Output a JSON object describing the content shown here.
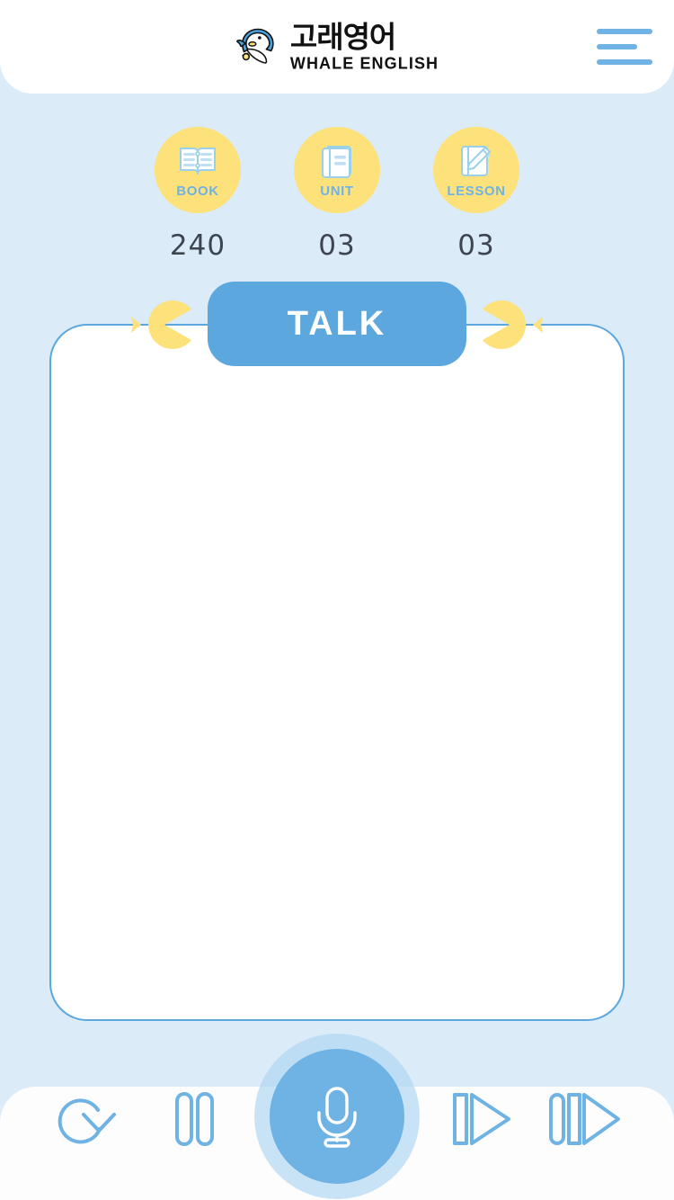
{
  "app": {
    "background_color": "#dbebf8",
    "accent_blue": "#5ba7de",
    "accent_yellow": "#fde27c"
  },
  "header": {
    "brand_korean": "고래영어",
    "brand_english": "WHALE ENGLISH",
    "logo_icon": "whale-logo-icon",
    "menu_icon": "hamburger-menu-icon"
  },
  "stats": [
    {
      "label": "BOOK",
      "value": "240",
      "icon": "open-book-icon"
    },
    {
      "label": "UNIT",
      "value": "03",
      "icon": "closed-book-icon"
    },
    {
      "label": "LESSON",
      "value": "03",
      "icon": "notebook-pencil-icon"
    }
  ],
  "talk": {
    "label": "TALK",
    "left_icon": "yellow-fish-left-icon",
    "right_icon": "yellow-fish-right-icon"
  },
  "content": {
    "text": ""
  },
  "controls": {
    "replay": {
      "label": "Replay",
      "icon": "replay-circular-arrow-icon"
    },
    "pause": {
      "label": "Pause",
      "icon": "pause-icon"
    },
    "record": {
      "label": "Record",
      "icon": "microphone-icon"
    },
    "next": {
      "label": "Next",
      "icon": "next-track-icon"
    },
    "skip": {
      "label": "Skip",
      "icon": "skip-forward-icon"
    }
  }
}
